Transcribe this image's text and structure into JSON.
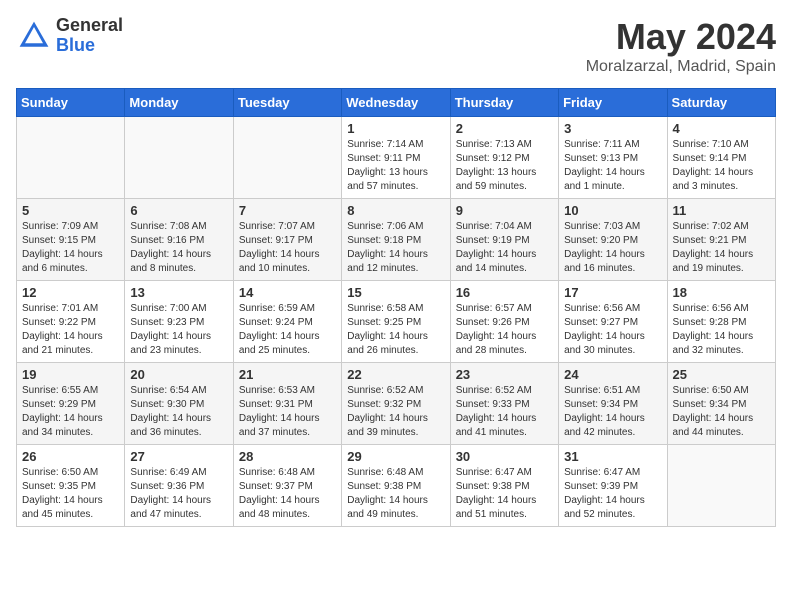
{
  "logo": {
    "general": "General",
    "blue": "Blue"
  },
  "title": "May 2024",
  "location": "Moralzarzal, Madrid, Spain",
  "days_of_week": [
    "Sunday",
    "Monday",
    "Tuesday",
    "Wednesday",
    "Thursday",
    "Friday",
    "Saturday"
  ],
  "weeks": [
    [
      {
        "num": "",
        "info": ""
      },
      {
        "num": "",
        "info": ""
      },
      {
        "num": "",
        "info": ""
      },
      {
        "num": "1",
        "info": "Sunrise: 7:14 AM\nSunset: 9:11 PM\nDaylight: 13 hours and 57 minutes."
      },
      {
        "num": "2",
        "info": "Sunrise: 7:13 AM\nSunset: 9:12 PM\nDaylight: 13 hours and 59 minutes."
      },
      {
        "num": "3",
        "info": "Sunrise: 7:11 AM\nSunset: 9:13 PM\nDaylight: 14 hours and 1 minute."
      },
      {
        "num": "4",
        "info": "Sunrise: 7:10 AM\nSunset: 9:14 PM\nDaylight: 14 hours and 3 minutes."
      }
    ],
    [
      {
        "num": "5",
        "info": "Sunrise: 7:09 AM\nSunset: 9:15 PM\nDaylight: 14 hours and 6 minutes."
      },
      {
        "num": "6",
        "info": "Sunrise: 7:08 AM\nSunset: 9:16 PM\nDaylight: 14 hours and 8 minutes."
      },
      {
        "num": "7",
        "info": "Sunrise: 7:07 AM\nSunset: 9:17 PM\nDaylight: 14 hours and 10 minutes."
      },
      {
        "num": "8",
        "info": "Sunrise: 7:06 AM\nSunset: 9:18 PM\nDaylight: 14 hours and 12 minutes."
      },
      {
        "num": "9",
        "info": "Sunrise: 7:04 AM\nSunset: 9:19 PM\nDaylight: 14 hours and 14 minutes."
      },
      {
        "num": "10",
        "info": "Sunrise: 7:03 AM\nSunset: 9:20 PM\nDaylight: 14 hours and 16 minutes."
      },
      {
        "num": "11",
        "info": "Sunrise: 7:02 AM\nSunset: 9:21 PM\nDaylight: 14 hours and 19 minutes."
      }
    ],
    [
      {
        "num": "12",
        "info": "Sunrise: 7:01 AM\nSunset: 9:22 PM\nDaylight: 14 hours and 21 minutes."
      },
      {
        "num": "13",
        "info": "Sunrise: 7:00 AM\nSunset: 9:23 PM\nDaylight: 14 hours and 23 minutes."
      },
      {
        "num": "14",
        "info": "Sunrise: 6:59 AM\nSunset: 9:24 PM\nDaylight: 14 hours and 25 minutes."
      },
      {
        "num": "15",
        "info": "Sunrise: 6:58 AM\nSunset: 9:25 PM\nDaylight: 14 hours and 26 minutes."
      },
      {
        "num": "16",
        "info": "Sunrise: 6:57 AM\nSunset: 9:26 PM\nDaylight: 14 hours and 28 minutes."
      },
      {
        "num": "17",
        "info": "Sunrise: 6:56 AM\nSunset: 9:27 PM\nDaylight: 14 hours and 30 minutes."
      },
      {
        "num": "18",
        "info": "Sunrise: 6:56 AM\nSunset: 9:28 PM\nDaylight: 14 hours and 32 minutes."
      }
    ],
    [
      {
        "num": "19",
        "info": "Sunrise: 6:55 AM\nSunset: 9:29 PM\nDaylight: 14 hours and 34 minutes."
      },
      {
        "num": "20",
        "info": "Sunrise: 6:54 AM\nSunset: 9:30 PM\nDaylight: 14 hours and 36 minutes."
      },
      {
        "num": "21",
        "info": "Sunrise: 6:53 AM\nSunset: 9:31 PM\nDaylight: 14 hours and 37 minutes."
      },
      {
        "num": "22",
        "info": "Sunrise: 6:52 AM\nSunset: 9:32 PM\nDaylight: 14 hours and 39 minutes."
      },
      {
        "num": "23",
        "info": "Sunrise: 6:52 AM\nSunset: 9:33 PM\nDaylight: 14 hours and 41 minutes."
      },
      {
        "num": "24",
        "info": "Sunrise: 6:51 AM\nSunset: 9:34 PM\nDaylight: 14 hours and 42 minutes."
      },
      {
        "num": "25",
        "info": "Sunrise: 6:50 AM\nSunset: 9:34 PM\nDaylight: 14 hours and 44 minutes."
      }
    ],
    [
      {
        "num": "26",
        "info": "Sunrise: 6:50 AM\nSunset: 9:35 PM\nDaylight: 14 hours and 45 minutes."
      },
      {
        "num": "27",
        "info": "Sunrise: 6:49 AM\nSunset: 9:36 PM\nDaylight: 14 hours and 47 minutes."
      },
      {
        "num": "28",
        "info": "Sunrise: 6:48 AM\nSunset: 9:37 PM\nDaylight: 14 hours and 48 minutes."
      },
      {
        "num": "29",
        "info": "Sunrise: 6:48 AM\nSunset: 9:38 PM\nDaylight: 14 hours and 49 minutes."
      },
      {
        "num": "30",
        "info": "Sunrise: 6:47 AM\nSunset: 9:38 PM\nDaylight: 14 hours and 51 minutes."
      },
      {
        "num": "31",
        "info": "Sunrise: 6:47 AM\nSunset: 9:39 PM\nDaylight: 14 hours and 52 minutes."
      },
      {
        "num": "",
        "info": ""
      }
    ]
  ]
}
